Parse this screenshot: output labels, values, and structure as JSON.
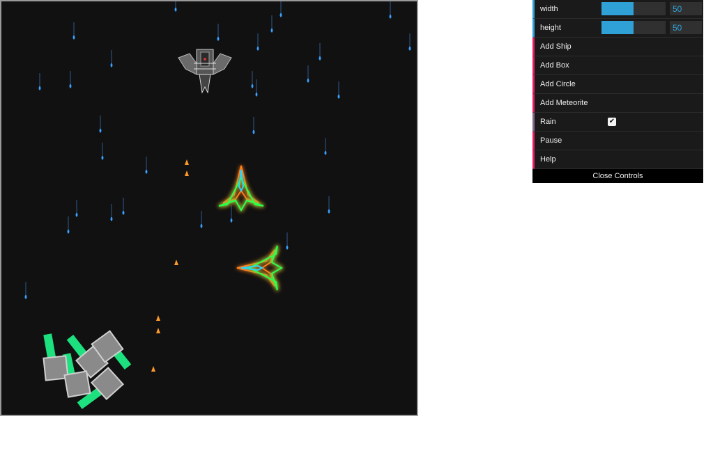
{
  "controls": {
    "width": {
      "label": "width",
      "value": 50,
      "min": 0,
      "max": 100
    },
    "height": {
      "label": "height",
      "value": 50,
      "min": 0,
      "max": 100
    },
    "add_ship": "Add Ship",
    "add_box": "Add Box",
    "add_circle": "Add Circle",
    "add_meteorite": "Add Meteorite",
    "rain": {
      "label": "Rain",
      "checked": true
    },
    "pause": "Pause",
    "help": "Help",
    "close": "Close Controls"
  },
  "colors": {
    "canvas_bg": "#111111",
    "raindrop": "#3aa0ff",
    "ember": "#ff9a2a",
    "ship_green": "#2dff4d",
    "ship_orange": "#ff7f1a",
    "ship_cyan": "#28d7ff",
    "box_gray": "#8a8a8a",
    "box_green": "#1de07e",
    "gui_number": "#2fa1d6",
    "gui_function": "#e61d5f",
    "gui_boolean": "#806787"
  },
  "icons": [
    "grey-fighter-icon",
    "neon-ship-icon",
    "raindrop-icon",
    "ember-icon",
    "checkmark-icon"
  ]
}
